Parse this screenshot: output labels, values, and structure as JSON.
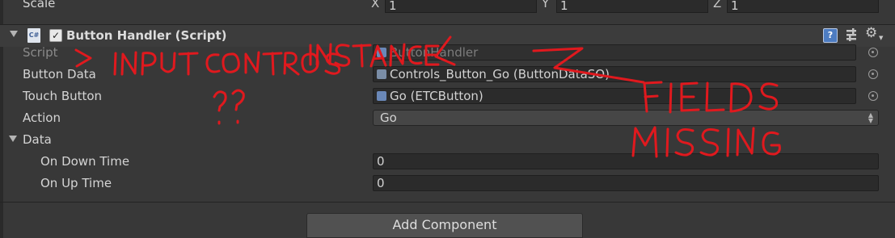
{
  "transform_row": {
    "label": "Scale",
    "x_axis": "X",
    "x_value": "1",
    "y_axis": "Y",
    "y_value": "1",
    "z_axis": "Z",
    "z_value": "1"
  },
  "component": {
    "title": "Button Handler (Script)",
    "enabled": true,
    "fields": [
      {
        "label": "Script",
        "value": "ButtonHandler"
      },
      {
        "label": "Button Data",
        "value": "Controls_Button_Go (ButtonDataSO)"
      },
      {
        "label": "Touch Button",
        "value": "Go (ETCButton)"
      }
    ],
    "action": {
      "label": "Action",
      "selected": "Go"
    },
    "data_group": {
      "label": "Data",
      "fields": [
        {
          "label": "On Down Time",
          "value": "0"
        },
        {
          "label": "On Up Time",
          "value": "0"
        }
      ]
    }
  },
  "add_component_label": "Add Component",
  "annotations": {
    "instance_note": "> INPUT CONTROLS INSTANCE <",
    "question": "??",
    "missing_line1": "FIELDS",
    "missing_line2": "MISSING"
  },
  "colors": {
    "panel": "#383838",
    "field": "#2b2b2b",
    "annotation": "#e0191e"
  },
  "icons": [
    "csharp-script-icon",
    "checkbox-icon",
    "help-icon",
    "preset-icon",
    "gear-icon",
    "foldout-arrow-icon",
    "object-picker-icon",
    "dropdown-arrow-icon"
  ]
}
